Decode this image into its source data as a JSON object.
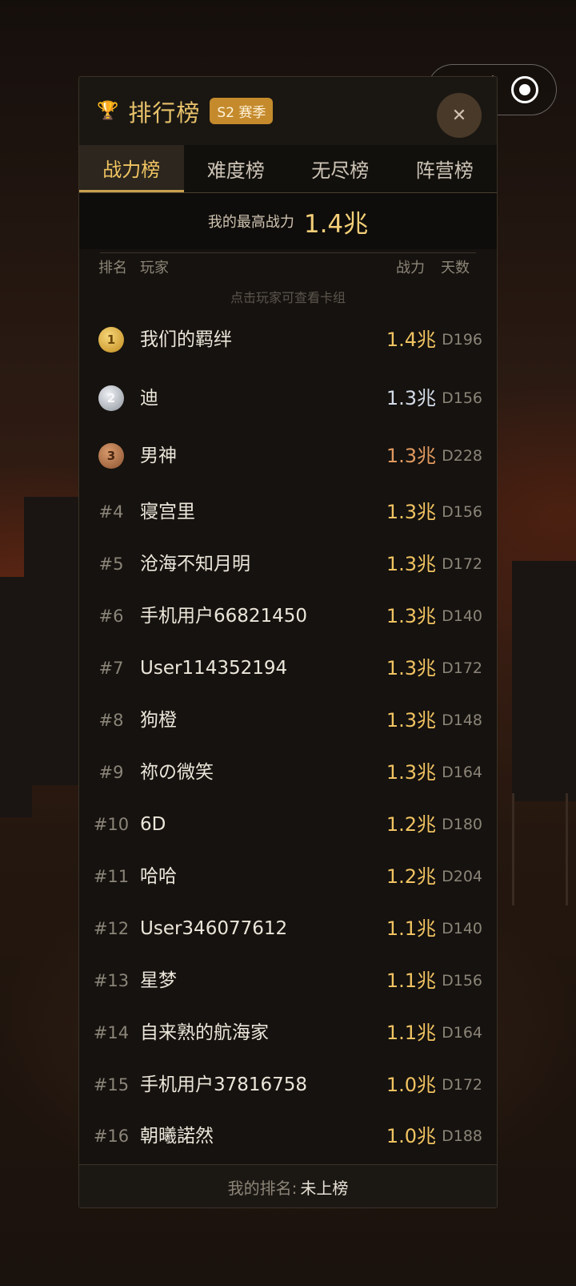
{
  "capsule": {
    "more_icon": "more-dots-icon",
    "target_icon": "target-icon"
  },
  "header": {
    "trophy_icon": "trophy-icon",
    "title": "排行榜",
    "season": "S2 赛季",
    "close": "✕"
  },
  "tabs": [
    {
      "label": "战力榜",
      "active": true
    },
    {
      "label": "难度榜",
      "active": false
    },
    {
      "label": "无尽榜",
      "active": false
    },
    {
      "label": "阵营榜",
      "active": false
    }
  ],
  "best": {
    "label": "我的最高战力",
    "value": "1.4兆"
  },
  "columns": {
    "rank": "排名",
    "player": "玩家",
    "power": "战力",
    "days": "天数"
  },
  "hint": "点击玩家可查看卡组",
  "rows": [
    {
      "rank": "1",
      "name": "我们的羁绊",
      "power": "1.4兆",
      "days": "D196",
      "medal": "gold"
    },
    {
      "rank": "2",
      "name": "迪",
      "power": "1.3兆",
      "days": "D156",
      "medal": "silver"
    },
    {
      "rank": "3",
      "name": "男神",
      "power": "1.3兆",
      "days": "D228",
      "medal": "bronze"
    },
    {
      "rank": "#4",
      "name": "寝宫里",
      "power": "1.3兆",
      "days": "D156"
    },
    {
      "rank": "#5",
      "name": "沧海不知月明",
      "power": "1.3兆",
      "days": "D172"
    },
    {
      "rank": "#6",
      "name": "手机用户66821450",
      "power": "1.3兆",
      "days": "D140"
    },
    {
      "rank": "#7",
      "name": "User114352194",
      "power": "1.3兆",
      "days": "D172"
    },
    {
      "rank": "#8",
      "name": "狗橙",
      "power": "1.3兆",
      "days": "D148"
    },
    {
      "rank": "#9",
      "name": "祢の微笑",
      "power": "1.3兆",
      "days": "D164"
    },
    {
      "rank": "#10",
      "name": "6D",
      "power": "1.2兆",
      "days": "D180"
    },
    {
      "rank": "#11",
      "name": "哈哈",
      "power": "1.2兆",
      "days": "D204"
    },
    {
      "rank": "#12",
      "name": "User346077612",
      "power": "1.1兆",
      "days": "D140"
    },
    {
      "rank": "#13",
      "name": "星梦",
      "power": "1.1兆",
      "days": "D156"
    },
    {
      "rank": "#14",
      "name": "自来熟的航海家",
      "power": "1.1兆",
      "days": "D164"
    },
    {
      "rank": "#15",
      "name": "手机用户37816758",
      "power": "1.0兆",
      "days": "D172"
    },
    {
      "rank": "#16",
      "name": "朝曦諾然",
      "power": "1.0兆",
      "days": "D188"
    }
  ],
  "footer": {
    "label": "我的排名:",
    "value": "未上榜"
  }
}
